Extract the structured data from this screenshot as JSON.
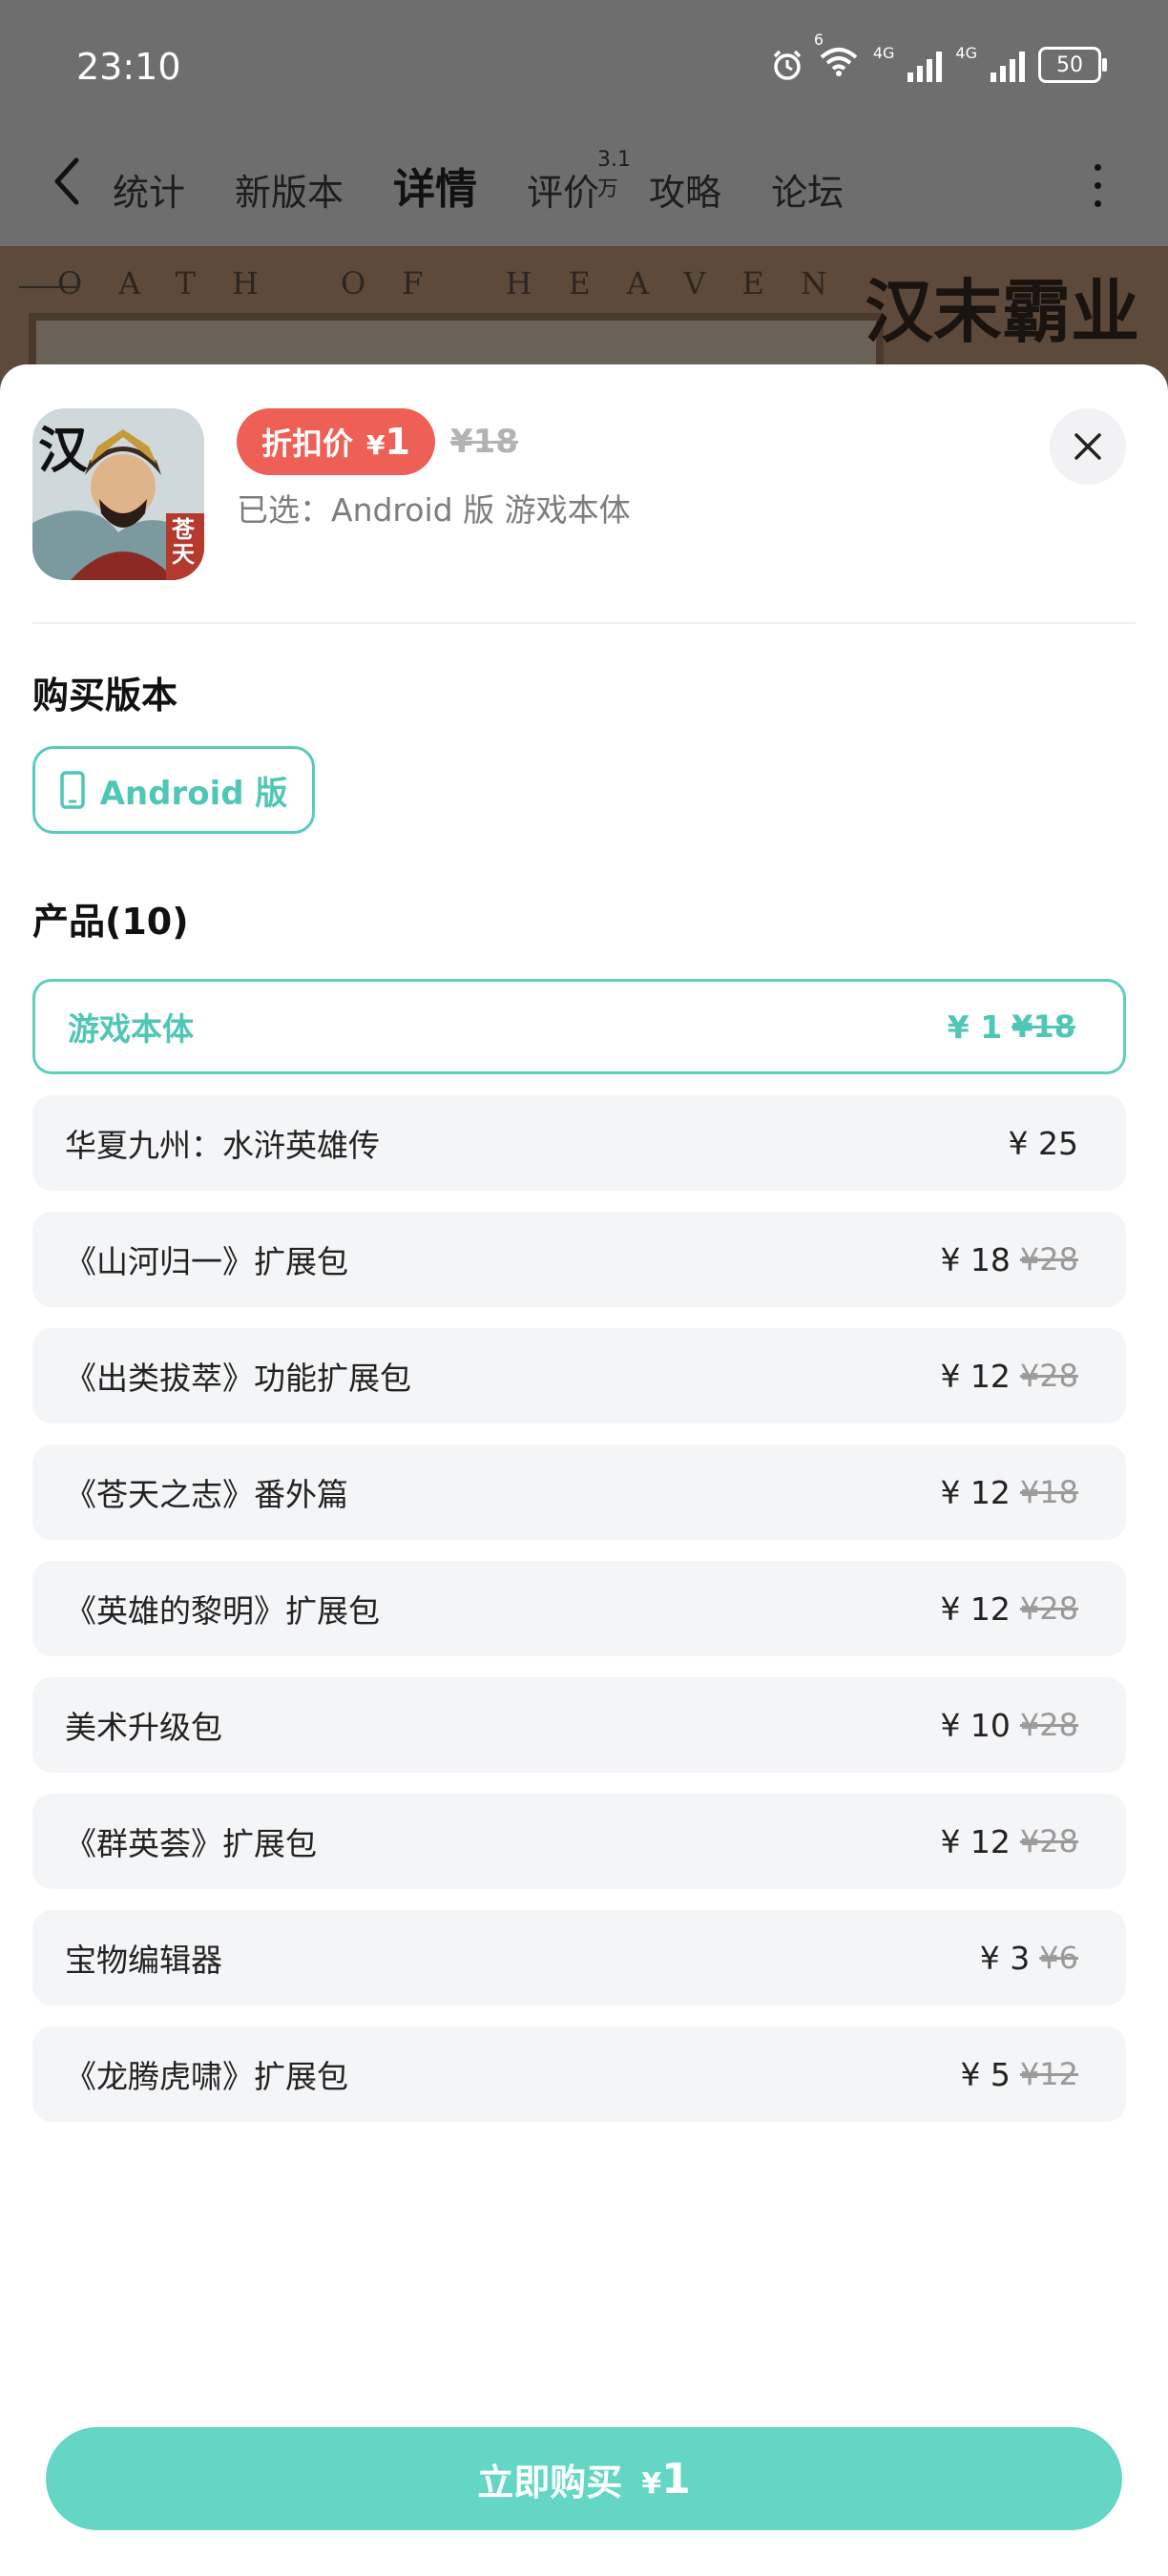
{
  "status_bar": {
    "time": "23:10",
    "net_label_1": "6",
    "net_label_2": "4G",
    "net_label_3": "4G",
    "battery": "50"
  },
  "nav": {
    "tabs": [
      "统计",
      "新版本",
      "详情",
      "评价",
      "攻略",
      "论坛"
    ],
    "active_index": 2,
    "review_count": "3.1万"
  },
  "banner": {
    "text": "OATH OF HEAVEN",
    "logo": "汉末霸业"
  },
  "product_header": {
    "discount_label": "折扣价",
    "currency": "¥",
    "price": "1",
    "original_price": "¥18",
    "selected_text": "已选：Android 版 游戏本体",
    "icon_text": "汉",
    "icon_subtext": "苍天"
  },
  "version_section": {
    "title": "购买版本",
    "option": "Android 版"
  },
  "products_section": {
    "title": "产品(10)",
    "items": [
      {
        "name": "游戏本体",
        "price": "¥ 1",
        "original": "¥18",
        "selected": true
      },
      {
        "name": "华夏九州：水浒英雄传",
        "price": "¥ 25",
        "original": ""
      },
      {
        "name": "《山河归一》扩展包",
        "price": "¥ 18",
        "original": "¥28"
      },
      {
        "name": "《出类拔萃》功能扩展包",
        "price": "¥ 12",
        "original": "¥28"
      },
      {
        "name": "《苍天之志》番外篇",
        "price": "¥ 12",
        "original": "¥18"
      },
      {
        "name": "《英雄的黎明》扩展包",
        "price": "¥ 12",
        "original": "¥28"
      },
      {
        "name": "美术升级包",
        "price": "¥ 10",
        "original": "¥28"
      },
      {
        "name": "《群英荟》扩展包",
        "price": "¥ 12",
        "original": "¥28"
      },
      {
        "name": "宝物编辑器",
        "price": "¥ 3",
        "original": "¥6"
      },
      {
        "name": "《龙腾虎啸》扩展包",
        "price": "¥ 5",
        "original": "¥12"
      }
    ]
  },
  "buy_button": {
    "label": "立即购买",
    "currency": "¥",
    "price": "1"
  },
  "colors": {
    "accent": "#5ccfbf",
    "discount": "#ee5f55",
    "buy_button": "#63d6c4"
  }
}
